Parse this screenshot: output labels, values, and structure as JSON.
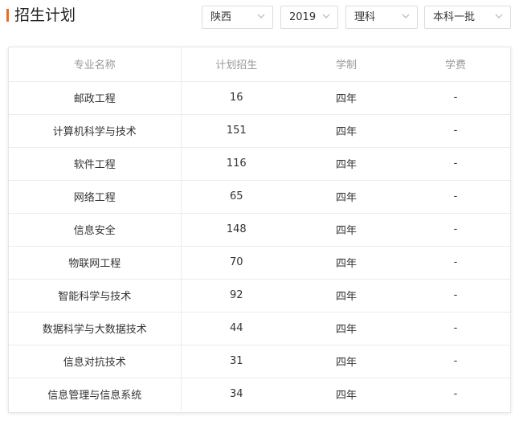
{
  "header": {
    "title": "招生计划",
    "accent_color": "#f06a1d"
  },
  "filters": [
    {
      "name": "province-select",
      "value": "陕西"
    },
    {
      "name": "year-select",
      "value": "2019"
    },
    {
      "name": "subject-select",
      "value": "理科"
    },
    {
      "name": "batch-select",
      "value": "本科一批"
    }
  ],
  "icons": {
    "chevron": "chevron-down-icon"
  },
  "table": {
    "columns": [
      "专业名称",
      "计划招生",
      "学制",
      "学费"
    ],
    "rows": [
      [
        "邮政工程",
        "16",
        "四年",
        "-"
      ],
      [
        "计算机科学与技术",
        "151",
        "四年",
        "-"
      ],
      [
        "软件工程",
        "116",
        "四年",
        "-"
      ],
      [
        "网络工程",
        "65",
        "四年",
        "-"
      ],
      [
        "信息安全",
        "148",
        "四年",
        "-"
      ],
      [
        "物联网工程",
        "70",
        "四年",
        "-"
      ],
      [
        "智能科学与技术",
        "92",
        "四年",
        "-"
      ],
      [
        "数据科学与大数据技术",
        "44",
        "四年",
        "-"
      ],
      [
        "信息对抗技术",
        "31",
        "四年",
        "-"
      ],
      [
        "信息管理与信息系统",
        "34",
        "四年",
        "-"
      ]
    ]
  }
}
